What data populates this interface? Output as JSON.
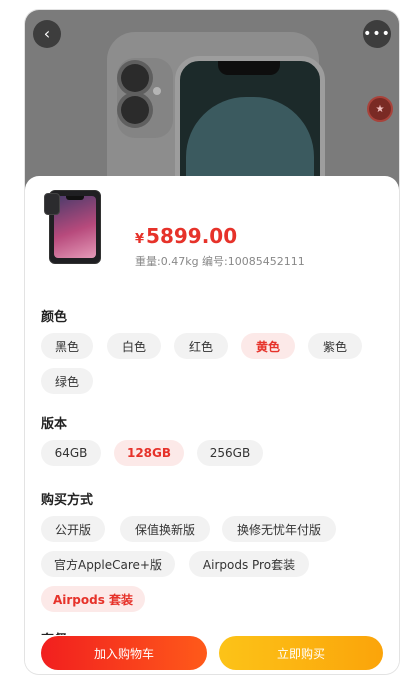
{
  "hero": {
    "back_icon": "chevron-left-icon",
    "more_icon": "more-horizontal-icon",
    "badge_icon": "promo-badge-icon"
  },
  "product": {
    "currency": "¥",
    "price": "5899.00",
    "meta": "重量:0.47kg 编号:10085452111",
    "price_color": "#e6322a"
  },
  "color": {
    "title": "颜色",
    "options": [
      "黑色",
      "白色",
      "红色",
      "黄色",
      "紫色",
      "绿色"
    ],
    "selected": "黄色"
  },
  "version": {
    "title": "版本",
    "options": [
      "64GB",
      "128GB",
      "256GB"
    ],
    "selected": "128GB"
  },
  "purchase": {
    "title": "购买方式",
    "options": [
      "公开版",
      "保值换新版",
      "换修无忧年付版",
      "官方AppleCare+版",
      "Airpods Pro套装",
      "Airpods 套装"
    ],
    "selected": "Airpods 套装"
  },
  "next_section": {
    "title": "套餐"
  },
  "actions": {
    "add_to_cart": "加入购物车",
    "buy_now": "立即购买",
    "cart_color": "#f11f1f",
    "buy_color": "#fcc318"
  }
}
